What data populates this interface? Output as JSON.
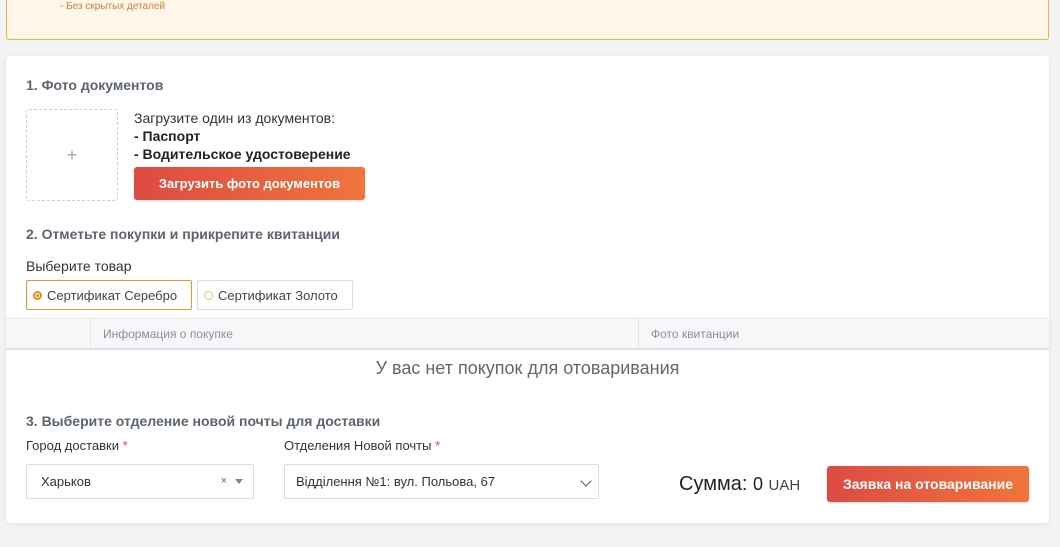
{
  "notice": {
    "text": "- Без скрытых деталей"
  },
  "step1": {
    "title": "1. Фото документов",
    "upload_plus": "+",
    "instruction": "Загрузите один из документов:",
    "doc1": "- Паспорт",
    "doc2": "- Водительское удостоверение",
    "upload_button": "Загрузить фото документов"
  },
  "step2": {
    "title": "2. Отметьте покупки и прикрепите квитанции",
    "choose_label": "Выберите товар",
    "options": [
      {
        "label": "Сертификат Серебро",
        "selected": true
      },
      {
        "label": "Сертификат Золото",
        "selected": false
      }
    ],
    "table": {
      "columns": [
        "Информация о покупке",
        "Фото квитанции"
      ],
      "empty_text": "У вас нет покупок для отоваривания"
    }
  },
  "step3": {
    "title": "3. Выберите отделение новой почты для доставки",
    "city_label": "Город доставки",
    "city_value": "Харьков",
    "branch_label": "Отделения Новой почты",
    "branch_value": "Відділення №1: вул. Польова, 67",
    "required_mark": "*",
    "clear_icon": "×"
  },
  "summary": {
    "label": "Сумма:",
    "value": "0",
    "currency": "UAH",
    "submit_button": "Заявка на отоваривание"
  },
  "colors": {
    "accent": "#e9962c",
    "button_start": "#dc4b42",
    "button_end": "#f0743d",
    "required": "#e14b3f"
  }
}
